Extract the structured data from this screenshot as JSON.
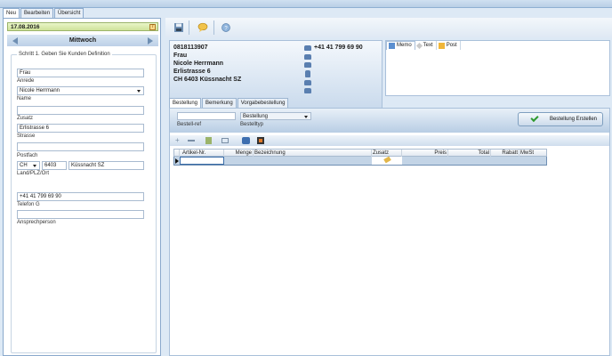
{
  "top_tabs": [
    "Neu",
    "Bearbeiten",
    "Übersicht"
  ],
  "left": {
    "date": "17.08.2016",
    "weekday": "Mittwoch",
    "group_title": "Schritt 1. Geben Sie Kunden Definition",
    "anrede_value": "Frau",
    "anrede_label": "Anrede",
    "name_value": "Nicole Herrmann",
    "name_label": "Name",
    "zusatz_value": "",
    "zusatz_label": "Zusatz",
    "strasse_value": "Erlistrasse 6",
    "strasse_label": "Strasse",
    "postfach_value": "",
    "postfach_label": "Postfach",
    "land_value": "CH",
    "plz_value": "6403",
    "ort_value": "Küssnacht SZ",
    "landplzort_label": "Land/PLZ/Ort",
    "telefon_value": "+41 41 799 69 90",
    "telefon_label": "Telefon G",
    "ansprech_value": "",
    "ansprech_label": "Ansprechperson"
  },
  "customer": {
    "number": "0818113907",
    "salutation": "Frau",
    "name": "Nicole Herrmann",
    "street": "Erlistrasse 6",
    "city": "CH 6403 Küssnacht SZ",
    "phone": "+41 41 799 69 90"
  },
  "memo_tabs": [
    "Memo",
    "Text",
    "Post"
  ],
  "sub_tabs": [
    "Bestellung",
    "Bemerkung",
    "Vorgabebestellung"
  ],
  "order": {
    "bestellref_label": "Bestell-ref",
    "bestellref_value": "",
    "bestelltyp_value": "Bestellung",
    "bestelltyp_label": "Bestelltyp",
    "create_label": "Bestellung Erstellen",
    "columns": [
      "Artikel-Nr.",
      "Menge",
      "Bezeichnung",
      "Zusatz",
      "Preis",
      "Total",
      "Rabatt",
      "MwSt"
    ]
  },
  "colors": {
    "accent": "#6f8fb3",
    "date_bar": "#cfe39a",
    "selected_row": "#c3d4e6"
  }
}
